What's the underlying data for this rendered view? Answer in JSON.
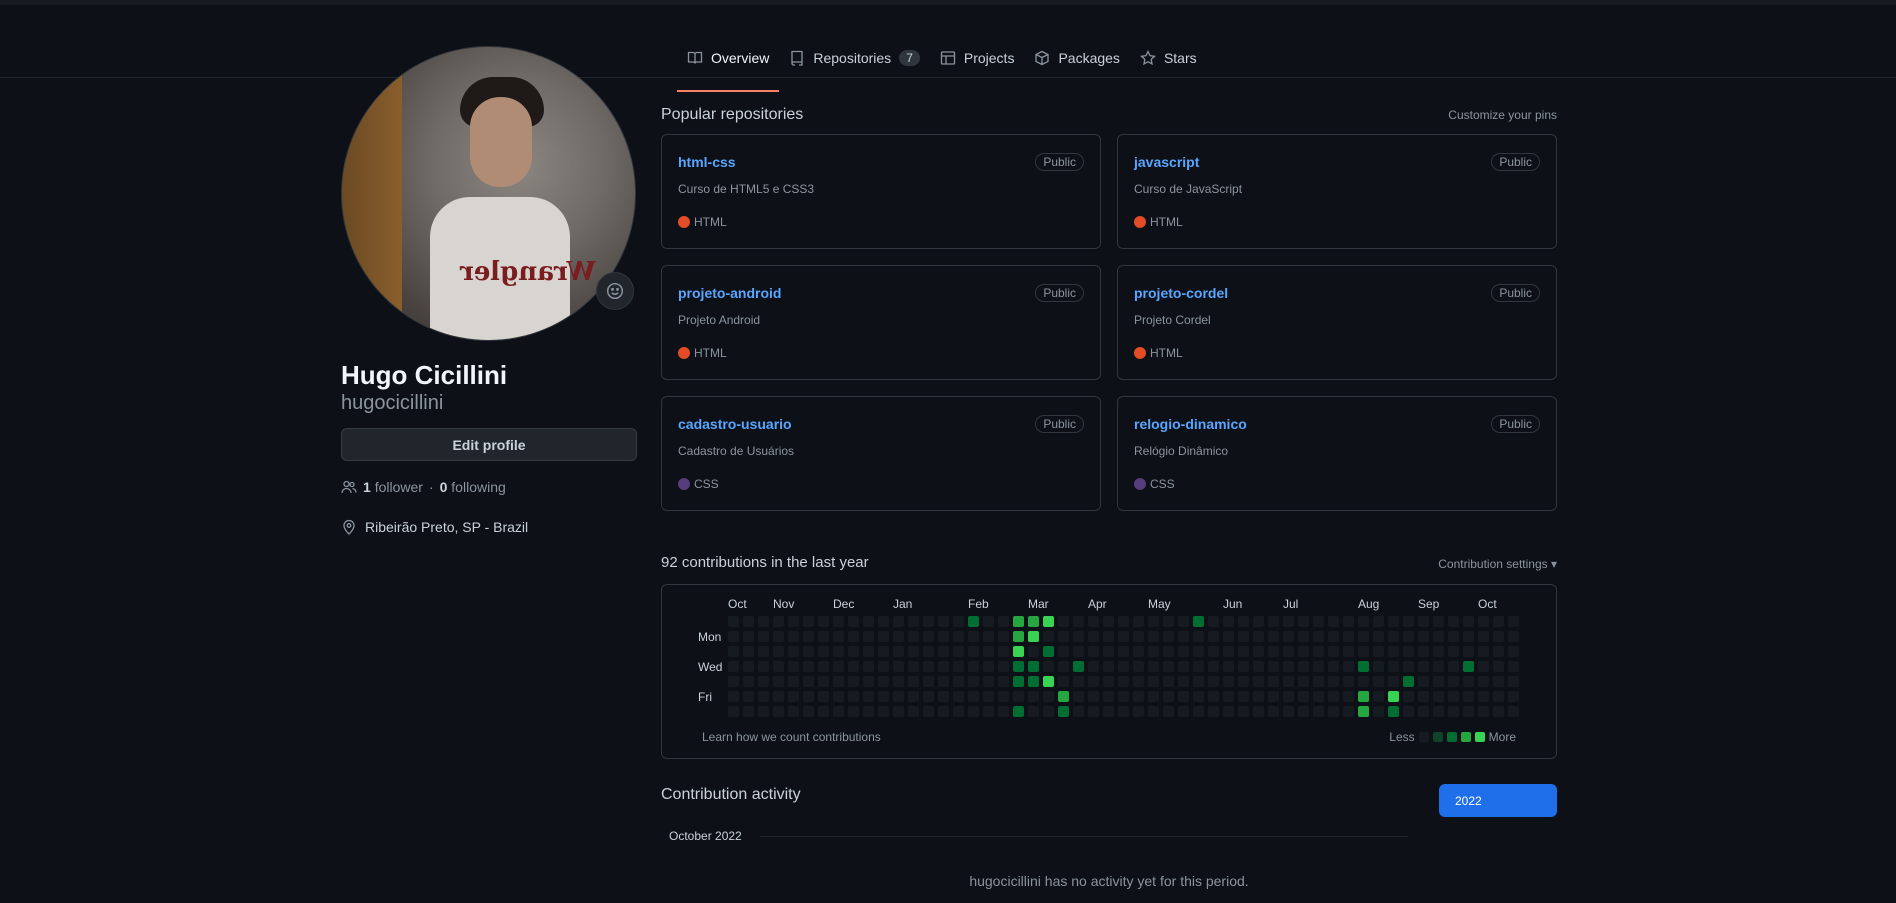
{
  "tabs": [
    {
      "label": "Overview",
      "icon": "book-icon"
    },
    {
      "label": "Repositories",
      "icon": "repo-icon",
      "count": "7"
    },
    {
      "label": "Projects",
      "icon": "table-icon"
    },
    {
      "label": "Packages",
      "icon": "package-icon"
    },
    {
      "label": "Stars",
      "icon": "star-icon"
    }
  ],
  "profile": {
    "name": "Hugo Cicillini",
    "login": "hugocicillini",
    "edit_label": "Edit profile",
    "followers": "1",
    "followers_label": "follower",
    "separator": "·",
    "following": "0",
    "following_label": "following",
    "location": "Ribeirão Preto, SP - Brazil",
    "avatar_text": "Wrangler"
  },
  "popular": {
    "title": "Popular repositories",
    "customize": "Customize your pins",
    "repos": [
      {
        "name": "html-css",
        "visibility": "Public",
        "desc": "Curso de HTML5 e CSS3",
        "lang": "HTML",
        "lang_color": "#e34c26"
      },
      {
        "name": "javascript",
        "visibility": "Public",
        "desc": "Curso de JavaScript",
        "lang": "HTML",
        "lang_color": "#e34c26"
      },
      {
        "name": "projeto-android",
        "visibility": "Public",
        "desc": "Projeto Android",
        "lang": "HTML",
        "lang_color": "#e34c26"
      },
      {
        "name": "projeto-cordel",
        "visibility": "Public",
        "desc": "Projeto Cordel",
        "lang": "HTML",
        "lang_color": "#e34c26"
      },
      {
        "name": "cadastro-usuario",
        "visibility": "Public",
        "desc": "Cadastro de Usuários",
        "lang": "CSS",
        "lang_color": "#563d7c"
      },
      {
        "name": "relogio-dinamico",
        "visibility": "Public",
        "desc": "Relógio Dinâmico",
        "lang": "CSS",
        "lang_color": "#563d7c"
      }
    ]
  },
  "contributions": {
    "title": "92 contributions in the last year",
    "settings": "Contribution settings ▾",
    "months": [
      {
        "label": "Oct",
        "week": 0
      },
      {
        "label": "Nov",
        "week": 3
      },
      {
        "label": "Dec",
        "week": 7
      },
      {
        "label": "Jan",
        "week": 11
      },
      {
        "label": "Feb",
        "week": 16
      },
      {
        "label": "Mar",
        "week": 20
      },
      {
        "label": "Apr",
        "week": 24
      },
      {
        "label": "May",
        "week": 28
      },
      {
        "label": "Jun",
        "week": 33
      },
      {
        "label": "Jul",
        "week": 37
      },
      {
        "label": "Aug",
        "week": 42
      },
      {
        "label": "Sep",
        "week": 46
      },
      {
        "label": "Oct",
        "week": 50
      }
    ],
    "days": [
      "Mon",
      "Wed",
      "Fri"
    ],
    "weeks": 53,
    "active_cells": [
      [
        16,
        0,
        2
      ],
      [
        19,
        0,
        3
      ],
      [
        20,
        0,
        3
      ],
      [
        21,
        0,
        4
      ],
      [
        31,
        0,
        2
      ],
      [
        19,
        1,
        3
      ],
      [
        20,
        1,
        4
      ],
      [
        19,
        2,
        4
      ],
      [
        21,
        2,
        2
      ],
      [
        19,
        3,
        2
      ],
      [
        20,
        3,
        2
      ],
      [
        23,
        3,
        2
      ],
      [
        42,
        3,
        2
      ],
      [
        49,
        3,
        2
      ],
      [
        19,
        4,
        2
      ],
      [
        20,
        4,
        2
      ],
      [
        21,
        4,
        4
      ],
      [
        45,
        4,
        2
      ],
      [
        22,
        5,
        3
      ],
      [
        42,
        5,
        3
      ],
      [
        44,
        5,
        4
      ],
      [
        19,
        6,
        2
      ],
      [
        22,
        6,
        2
      ],
      [
        42,
        6,
        3
      ],
      [
        44,
        6,
        2
      ]
    ],
    "level_colors": [
      "#161b22",
      "#0e4429",
      "#006d32",
      "#26a641",
      "#39d353"
    ],
    "learn": "Learn how we count contributions",
    "less": "Less",
    "more": "More"
  },
  "activity": {
    "title": "Contribution activity",
    "year": "2022",
    "period": "October 2022",
    "empty": "hugocicillini has no activity yet for this period."
  }
}
